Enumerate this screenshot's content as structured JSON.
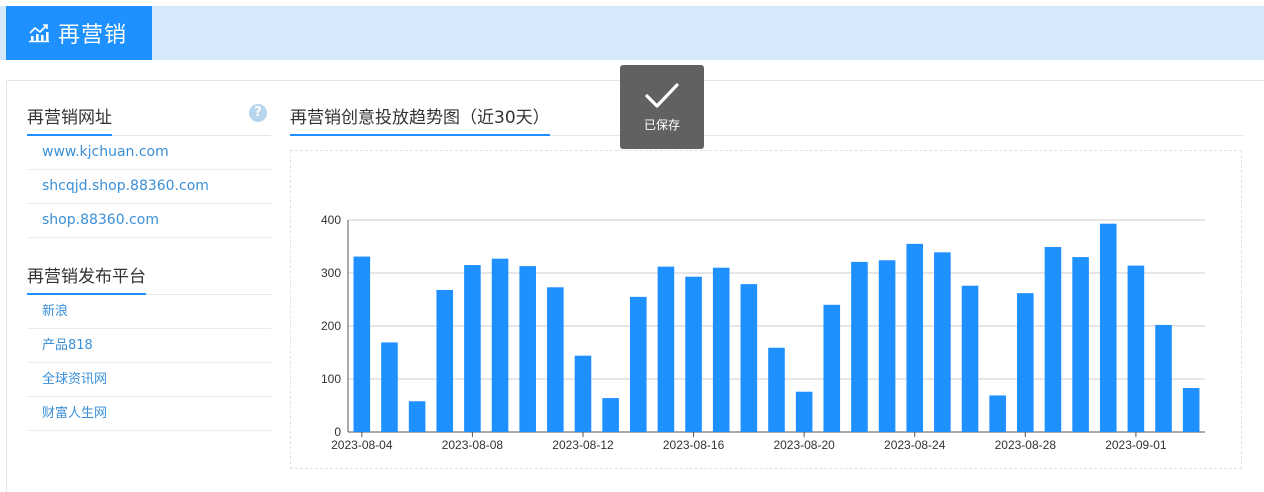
{
  "header": {
    "title": "再营销",
    "icon": "chart-icon",
    "accent": "#1e90ff",
    "band_color": "#d6e9fb"
  },
  "sidebar": {
    "url_section_title": "再营销网址",
    "urls": [
      "www.kjchuan.com",
      "shcqjd.shop.88360.com",
      "shop.88360.com"
    ],
    "platform_section_title": "再营销发布平台",
    "platforms": [
      "新浪",
      "产品818",
      "全球资讯网",
      "财富人生网"
    ]
  },
  "main": {
    "chart_title": "再营销创意投放趋势图（近30天）"
  },
  "toast": {
    "message": "已保存",
    "icon": "check-icon"
  },
  "chart_data": {
    "type": "bar",
    "color": "#1e90ff",
    "categories": [
      "2023-08-04",
      "2023-08-05",
      "2023-08-06",
      "2023-08-07",
      "2023-08-08",
      "2023-08-09",
      "2023-08-10",
      "2023-08-11",
      "2023-08-12",
      "2023-08-13",
      "2023-08-14",
      "2023-08-15",
      "2023-08-16",
      "2023-08-17",
      "2023-08-18",
      "2023-08-19",
      "2023-08-20",
      "2023-08-21",
      "2023-08-22",
      "2023-08-23",
      "2023-08-24",
      "2023-08-25",
      "2023-08-26",
      "2023-08-27",
      "2023-08-28",
      "2023-08-29",
      "2023-08-30",
      "2023-08-31",
      "2023-09-01",
      "2023-09-02",
      "2023-09-03"
    ],
    "values": [
      331,
      169,
      58,
      268,
      315,
      327,
      313,
      273,
      144,
      64,
      255,
      312,
      293,
      310,
      279,
      159,
      76,
      240,
      321,
      324,
      355,
      339,
      276,
      69,
      262,
      349,
      330,
      393,
      314,
      202,
      83
    ],
    "x_tick_labels": [
      "2023-08-04",
      "2023-08-08",
      "2023-08-12",
      "2023-08-16",
      "2023-08-20",
      "2023-08-24",
      "2023-08-28",
      "2023-09-01"
    ],
    "y_ticks": [
      0,
      100,
      200,
      300,
      400
    ],
    "ylim": [
      0,
      400
    ],
    "grid": true
  }
}
